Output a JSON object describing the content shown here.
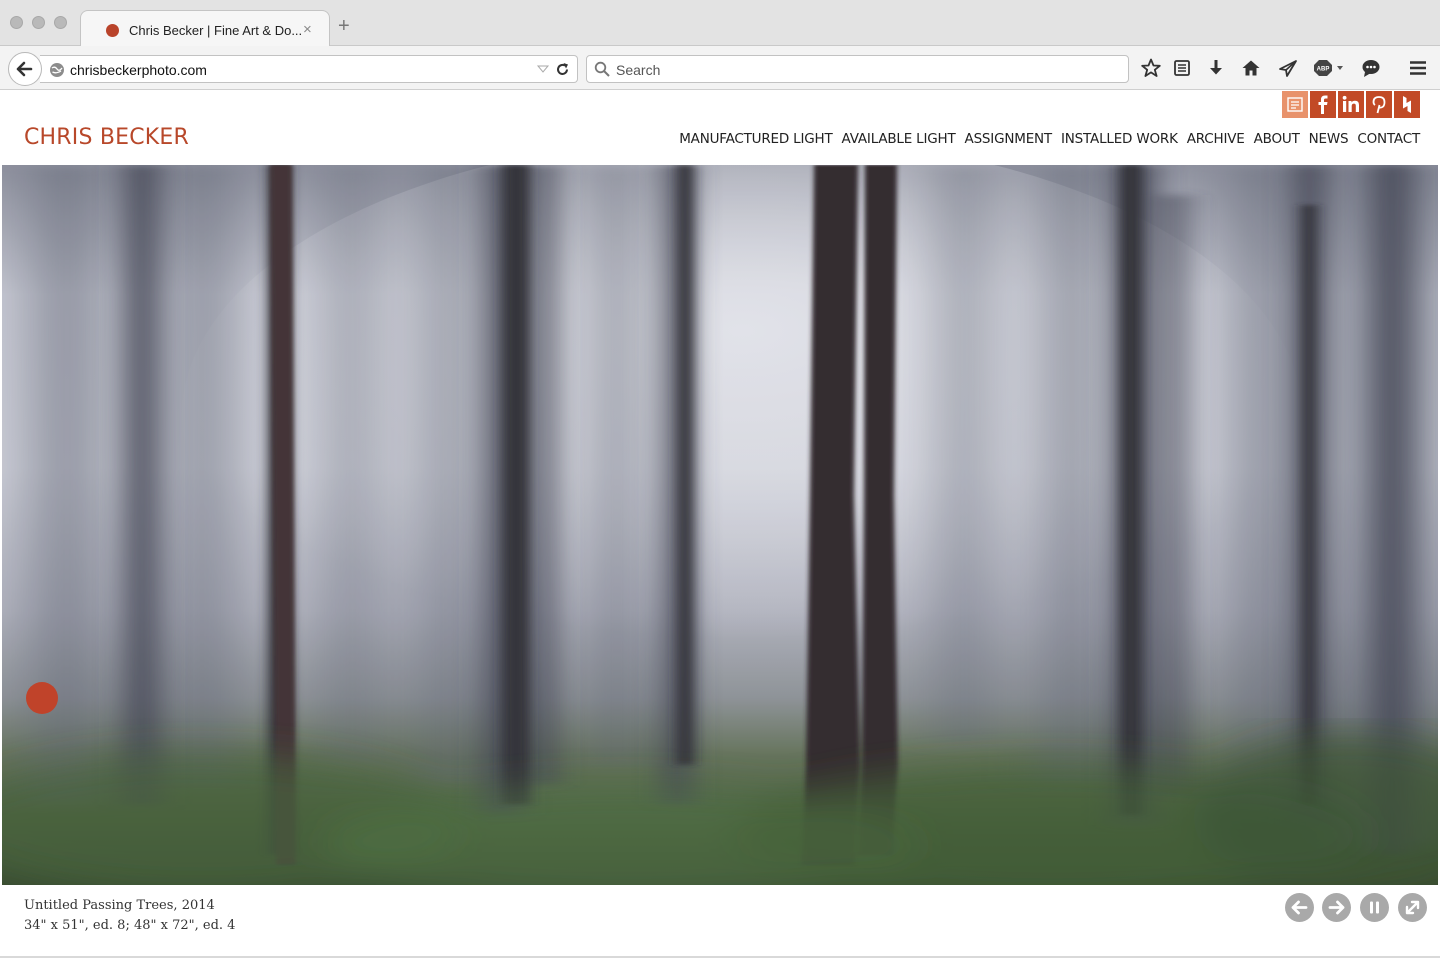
{
  "browser": {
    "tab_title": "Chris Becker | Fine Art & Do...",
    "tab_close": "×",
    "new_tab": "+",
    "url": "chrisbeckerphoto.com",
    "search_placeholder": "Search",
    "toolbar_icons": [
      "star-icon",
      "reading-list-icon",
      "download-icon",
      "home-icon",
      "send-icon",
      "adblock-icon",
      "chat-icon",
      "menu-icon"
    ]
  },
  "site": {
    "brand": "CHRIS BECKER",
    "brand_color": "#b8482a",
    "accent_color": "#c24a26",
    "social": [
      "blog-icon",
      "facebook-icon",
      "linkedin-icon",
      "pinterest-icon",
      "houzz-icon"
    ],
    "nav": [
      "MANUFACTURED LIGHT",
      "AVAILABLE LIGHT",
      "ASSIGNMENT",
      "INSTALLED WORK",
      "ARCHIVE",
      "ABOUT",
      "NEWS",
      "CONTACT"
    ]
  },
  "artwork": {
    "title": "Untitled Passing Trees, 2014",
    "details": "34\" x 51\", ed. 8; 48\" x 72\", ed. 4"
  },
  "slideshow_controls": [
    "previous-icon",
    "next-icon",
    "pause-icon",
    "fullscreen-icon"
  ]
}
